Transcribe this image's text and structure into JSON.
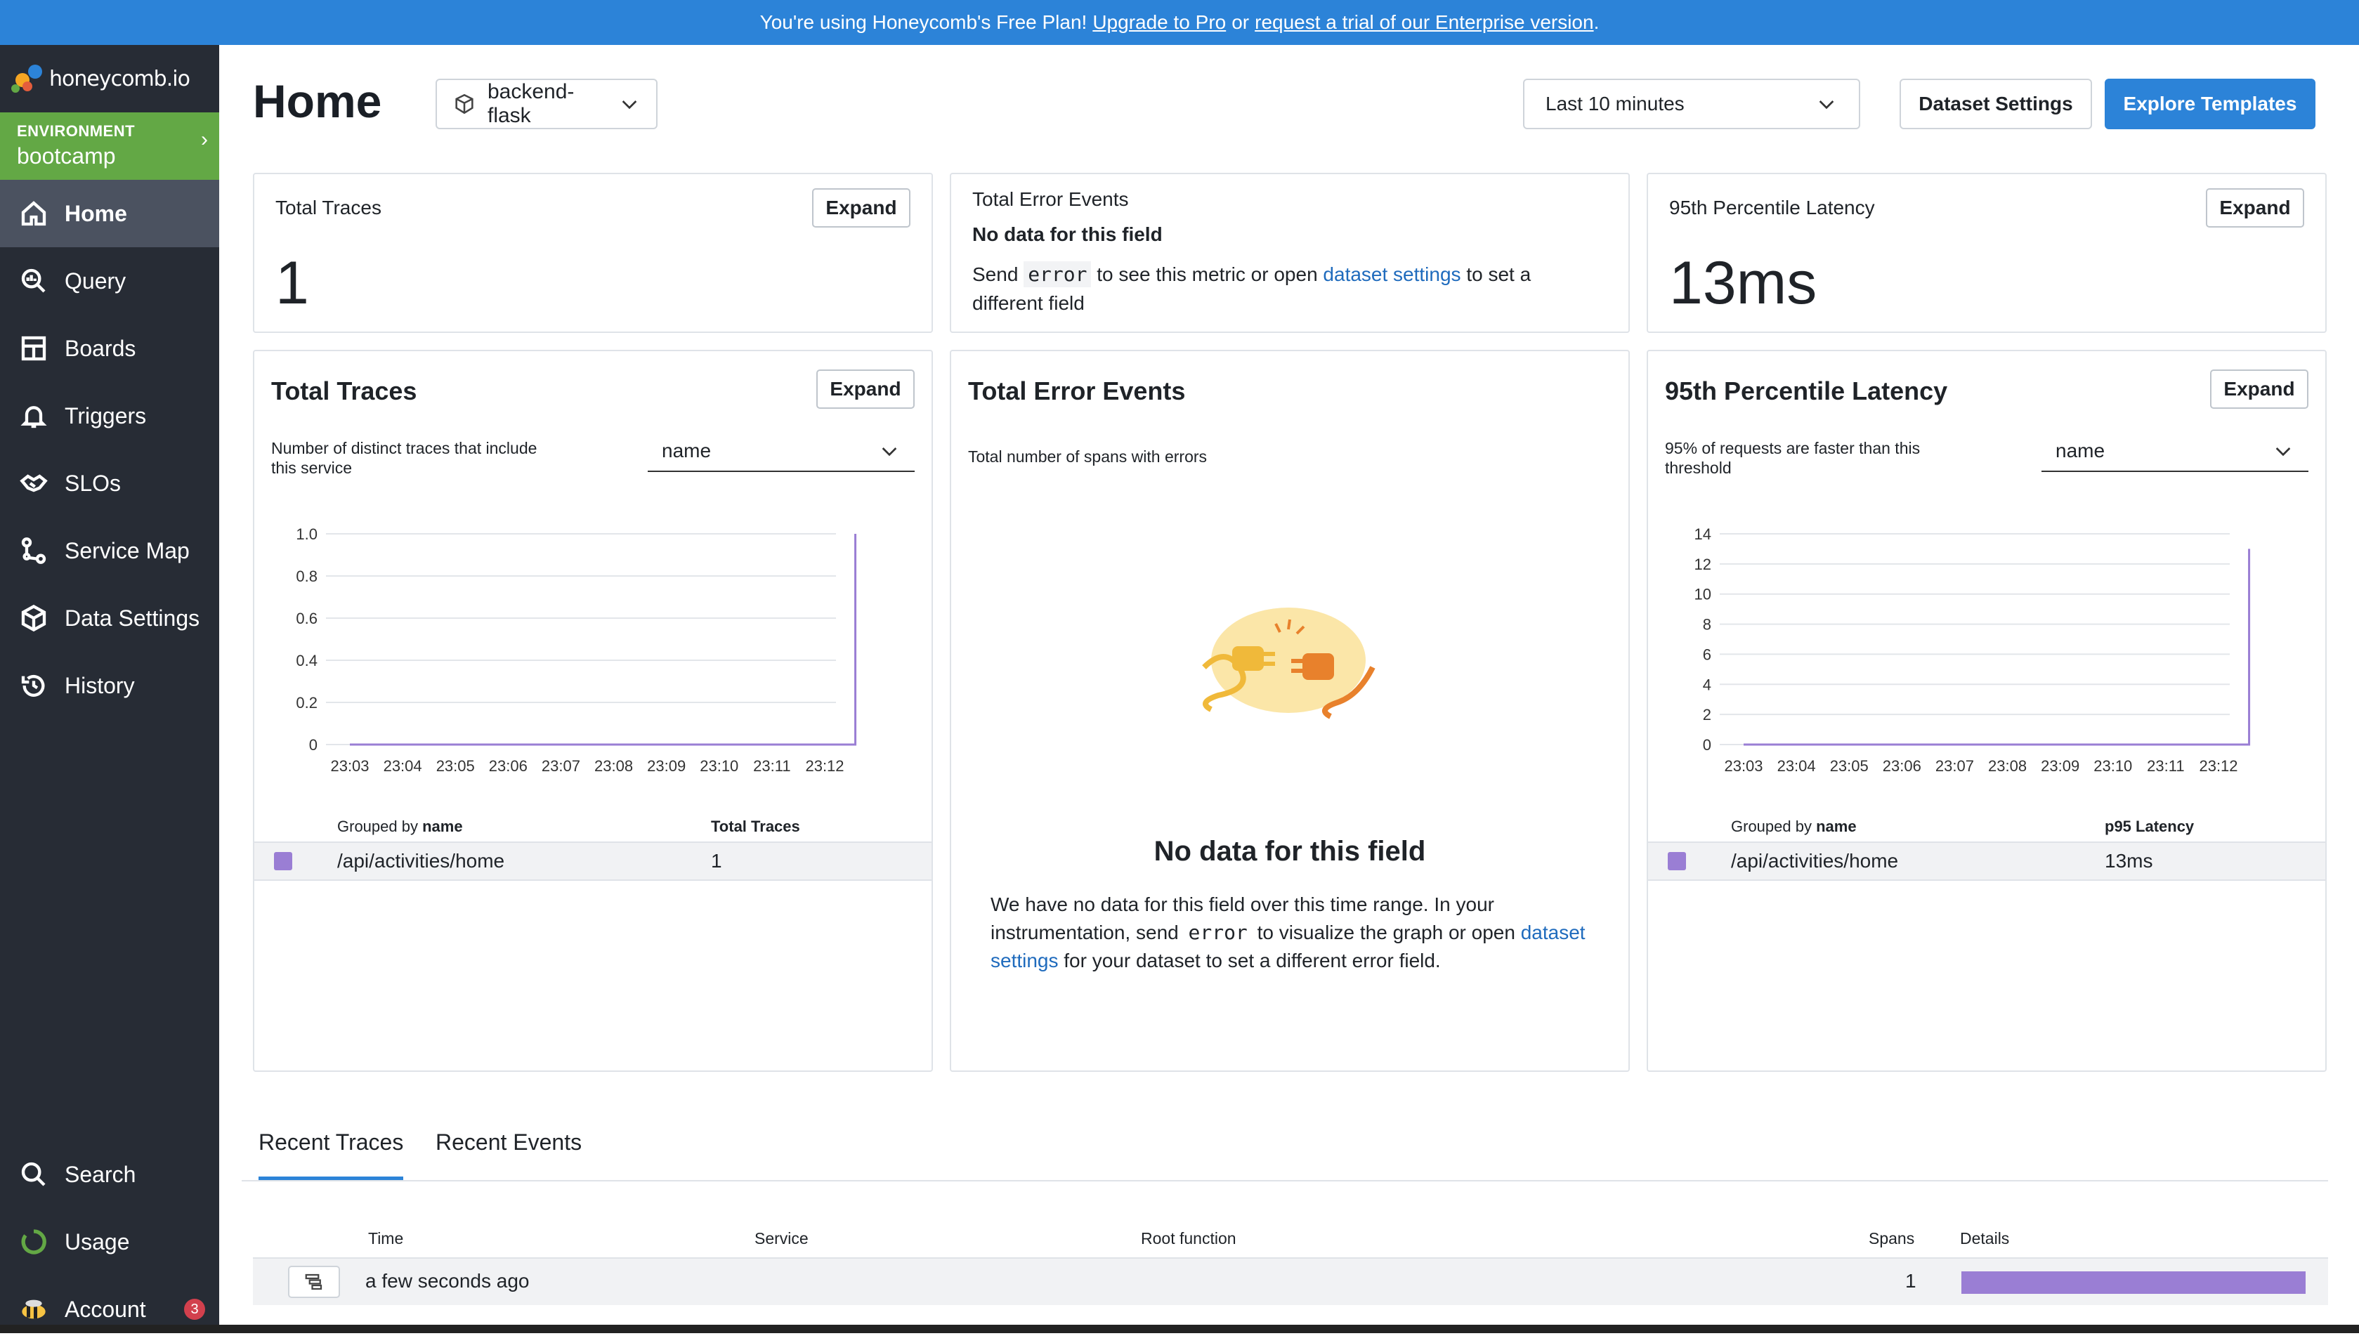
{
  "banner": {
    "prefix": "You're using Honeycomb's Free Plan!",
    "upgrade_link": "Upgrade to Pro",
    "middle": "or",
    "trial_link": "request a trial of our Enterprise version",
    "suffix": "."
  },
  "sidebar": {
    "logo_text": "honeycomb.io",
    "environment_label": "ENVIRONMENT",
    "environment_name": "bootcamp",
    "items": [
      {
        "label": "Home",
        "icon": "home-icon"
      },
      {
        "label": "Query",
        "icon": "query-icon"
      },
      {
        "label": "Boards",
        "icon": "boards-icon"
      },
      {
        "label": "Triggers",
        "icon": "bell-icon"
      },
      {
        "label": "SLOs",
        "icon": "handshake-icon"
      },
      {
        "label": "Service Map",
        "icon": "service-map-icon"
      },
      {
        "label": "Data Settings",
        "icon": "cube-icon"
      },
      {
        "label": "History",
        "icon": "history-icon"
      }
    ],
    "bottom_items": [
      {
        "label": "Search",
        "icon": "search-icon"
      },
      {
        "label": "Usage",
        "icon": "usage-icon"
      },
      {
        "label": "Account",
        "icon": "bee-icon",
        "badge": "3"
      }
    ]
  },
  "header": {
    "title": "Home",
    "dataset": "backend-flask",
    "time_range": "Last 10 minutes",
    "dataset_settings_label": "Dataset Settings",
    "explore_templates_label": "Explore Templates"
  },
  "summary": {
    "total_traces": {
      "label": "Total Traces",
      "value": "1",
      "expand": "Expand"
    },
    "total_errors": {
      "label": "Total Error Events",
      "no_data": "No data for this field",
      "send_prefix": "Send",
      "field": "error",
      "mid": "to see this metric or open",
      "link": "dataset settings",
      "suffix": "to set a",
      "line2": "different field"
    },
    "latency": {
      "label": "95th Percentile Latency",
      "value": "13ms",
      "expand": "Expand"
    }
  },
  "panels": {
    "traces": {
      "title": "Total Traces",
      "expand": "Expand",
      "desc1": "Number of distinct traces that include",
      "desc2": "this service",
      "group_by": "name",
      "table": {
        "grouped_by_prefix": "Grouped by",
        "grouped_by_field": "name",
        "metric_col": "Total Traces",
        "rows": [
          {
            "name": "/api/activities/home",
            "value": "1"
          }
        ]
      }
    },
    "errors": {
      "title": "Total Error Events",
      "desc": "Total number of spans with errors",
      "empty_title": "No data for this field",
      "p1": "We have no data for this field over this time range. In your",
      "p2a": "instrumentation, send",
      "p2field": "error",
      "p2b": "to visualize the graph or open",
      "p2link": "dataset",
      "p3link": "settings",
      "p3": "for your dataset to set a different error field."
    },
    "latency": {
      "title": "95th Percentile Latency",
      "expand": "Expand",
      "desc1": "95% of requests are faster than this",
      "desc2": "threshold",
      "group_by": "name",
      "table": {
        "grouped_by_prefix": "Grouped by",
        "grouped_by_field": "name",
        "metric_col": "p95 Latency",
        "rows": [
          {
            "name": "/api/activities/home",
            "value": "13ms"
          }
        ]
      }
    }
  },
  "chart_data": [
    {
      "type": "line",
      "x": [
        "23:03",
        "23:04",
        "23:05",
        "23:06",
        "23:07",
        "23:08",
        "23:09",
        "23:10",
        "23:11",
        "23:12"
      ],
      "yticks": [
        "0",
        "0.2",
        "0.4",
        "0.6",
        "0.8",
        "1.0"
      ],
      "ylim": [
        0,
        1.0
      ],
      "series": [
        {
          "values": [
            0,
            0,
            0,
            0,
            0,
            0,
            0,
            0,
            0,
            0,
            1.0
          ]
        }
      ],
      "color": "#9a7ed4"
    },
    {
      "type": "line",
      "x": [
        "23:03",
        "23:04",
        "23:05",
        "23:06",
        "23:07",
        "23:08",
        "23:09",
        "23:10",
        "23:11",
        "23:12"
      ],
      "yticks": [
        "0",
        "2",
        "4",
        "6",
        "8",
        "10",
        "12",
        "14"
      ],
      "ylim": [
        0,
        14
      ],
      "series": [
        {
          "values": [
            0,
            0,
            0,
            0,
            0,
            0,
            0,
            0,
            0,
            0,
            13
          ]
        }
      ],
      "color": "#9a7ed4"
    }
  ],
  "recent": {
    "tabs": [
      "Recent Traces",
      "Recent Events"
    ],
    "columns": [
      "Time",
      "Service",
      "Root function",
      "Spans",
      "Details"
    ],
    "rows": [
      {
        "time": "a few seconds ago",
        "service": "",
        "root": "",
        "spans": "1"
      }
    ]
  }
}
